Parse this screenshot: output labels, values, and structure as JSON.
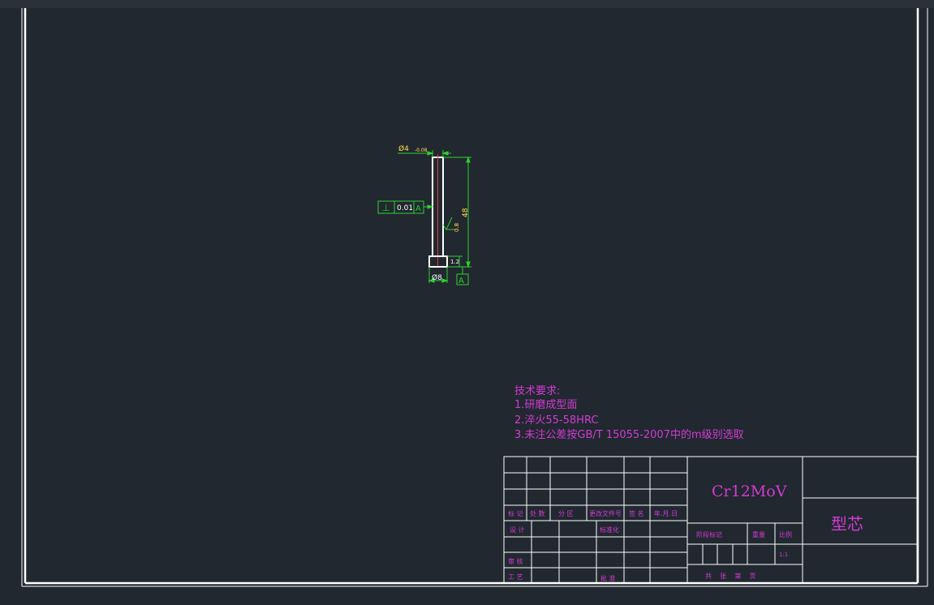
{
  "colors": {
    "background": "#212830",
    "frame": "#ffffff",
    "dimension": "#2fd02f",
    "annotation_text": "#ffe14a",
    "magenta_text": "#d43ad4",
    "table_line": "#ffffff",
    "part_outline": "#ffffff",
    "centerline": "#e23a3a"
  },
  "drawing": {
    "dim_top_diameter": "Ø4",
    "dim_top_tolerance": "-0.08",
    "dim_bottom_diameter": "Ø8",
    "dim_length": "48",
    "dim_head_height": "1.2",
    "surface_finish": "0.8",
    "geom_tol_symbol": "⊥",
    "geom_tol_value": "0.01",
    "geom_tol_datum": "A",
    "datum_label": "A"
  },
  "technical_requirements": {
    "heading": "技术要求:",
    "items": [
      "1.研磨成型面",
      "2.淬火55-58HRC",
      "3.未注公差按GB/T 15055-2007中的m级别选取"
    ]
  },
  "title_block": {
    "material": "Cr12MoV",
    "part_name": "型芯",
    "revision_headers": [
      "标 记",
      "处 数",
      "分 区",
      "更改文件号",
      "签 名",
      "年.月.日"
    ],
    "row_design": "设 计",
    "row_standardize": "标准化",
    "row_review": "审 核",
    "row_process": "工 艺",
    "row_approve": "批 准",
    "stage_mark": "阶段标记",
    "weight": "重量",
    "scale": "比例",
    "scale_value": "1:1",
    "sheets": "共    张    第    页"
  }
}
